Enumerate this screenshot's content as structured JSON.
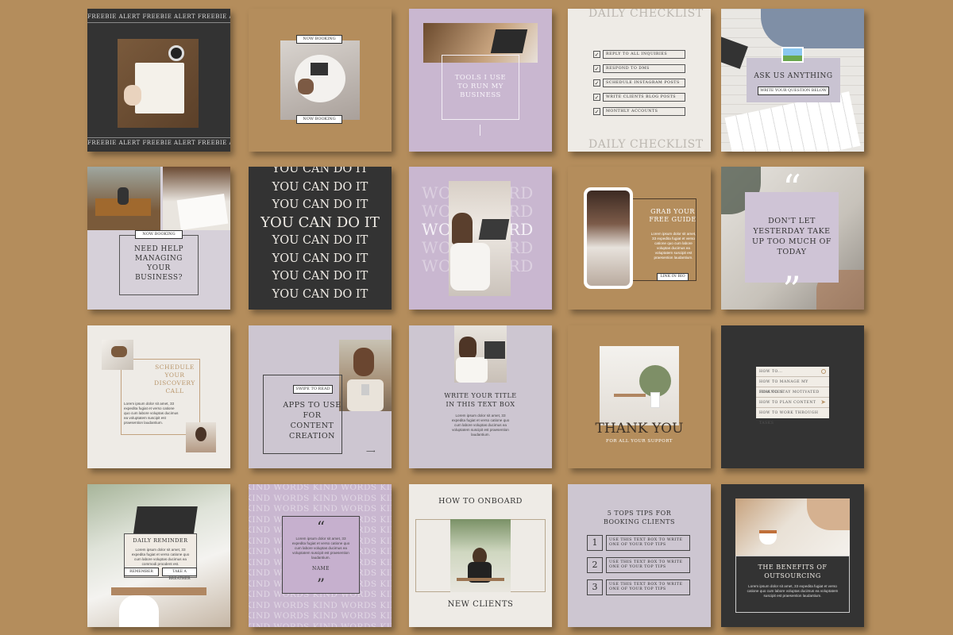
{
  "tiles": {
    "t1": {
      "banner": "FREEBIE ALERT",
      "banner_repeat": "FREEBIE ALERT  FREEBIE ALERT  FREEBIE ALERT"
    },
    "t2": {
      "top_label": "NOW BOOKING",
      "bottom_label": "NOW BOOKING"
    },
    "t3": {
      "text": "TOOLS I USE TO RUN MY BUSINESS"
    },
    "t4": {
      "title": "DAILY CHECKLIST",
      "items": [
        "REPLY TO ALL INQUIRIES",
        "RESPOND TO DMS",
        "SCHEDULE INSTAGRAM POSTS",
        "WRITE CLIENTS BLOG POSTS",
        "MONTHLY ACCOUNTS"
      ]
    },
    "t5": {
      "title": "ASK US ANYTHING",
      "field": "WRITE YOUR QUESTION BELOW"
    },
    "t6": {
      "label": "NOW BOOKING",
      "text": "NEED HELP MANAGING YOUR BUSINESS?"
    },
    "t7": {
      "line": "YOU CAN DO IT"
    },
    "t8": {
      "bg_word": "WORK HARD"
    },
    "t9": {
      "title": "GRAB YOUR FREE GUIDE",
      "body": "Lorem ipsum dolor sit amet, 33 expedita fugiat et verso catione quo cum labore voluptas ducimus ea voluptatem suscipit est praesention laudantium.",
      "button": "LINK IN BIO"
    },
    "t10": {
      "text": "DON'T LET YESTERDAY TAKE UP TOO MUCH OF TODAY",
      "open_quote": "“",
      "close_quote": "”"
    },
    "t11": {
      "title": "SCHEDULE YOUR DISCOVERY CALL",
      "body": "Lorem ipsum dolor sit amet, 33 expedita fugiat et verso catione quo cum labore voluptas ducimus ea voluptatem suscipit est praesention laudantium."
    },
    "t12": {
      "label": "SWIPE TO READ",
      "text": "APPS TO USE FOR CONTENT CREATION"
    },
    "t13": {
      "title": "WRITE YOUR TITLE IN THIS TEXT BOX",
      "body": "Lorem ipsum dolor sit amet, 33 expedita fugiat et verso catione quo cum labore voluptas ducimus ea voluptatem suscipit est praesention laudantium."
    },
    "t14": {
      "title": "THANK YOU",
      "subtitle": "FOR ALL YOUR SUPPORT"
    },
    "t15": {
      "search": "HOW TO...",
      "items": [
        "HOW TO MANAGE MY FINANCES",
        "HOW TO STAY MOTIVATED",
        "HOW TO PLAN CONTENT",
        "HOW TO WORK THROUGH TASKS"
      ]
    },
    "t16": {
      "title": "DAILY REMINDER",
      "body": "Lorem ipsum dolor sit amet, 33 expedita fugiat et verso catione quo cum labore voluptas ducimus ea commodi proodent est.",
      "btn1": "REMEMBER",
      "btn2": "TAKE A BREATHER"
    },
    "t17": {
      "bg_word": "KIND WORDS",
      "body": "Lorem ipsum dolor sit amet, 33 expedita fugiat et verso catione quo cum labore voluptas ducimus ea voluptatem suscipit est praesention laudantium.",
      "name": "NAME",
      "open_quote": "“",
      "close_quote": "”"
    },
    "t18": {
      "top": "HOW TO ONBOARD",
      "bottom": "NEW CLIENTS"
    },
    "t19": {
      "title": "5 TOPS TIPS FOR BOOKING CLIENTS",
      "tip": "USE THIS TEXT BOX TO WRITE ONE OF YOUR TOP TIPS",
      "numbers": [
        "1",
        "2",
        "3"
      ]
    },
    "t20": {
      "title": "THE BENEFITS OF OUTSOURCING",
      "body": "Lorem ipsum dolor sit amet, 33 expedita fugiat et verso catione quo cum labore voluptas ducimus ea voluptatem suscipit est praesention laudantium."
    }
  },
  "colors": {
    "background": "#b48d5c",
    "dark": "#333333",
    "lavender": "#c9b7d0",
    "grey_lavender": "#cdc6d1",
    "cream": "#eeebe6"
  },
  "icons": [
    "checkbox-icon",
    "search-icon",
    "cursor-icon",
    "arrow-right-icon",
    "quote-icon",
    "image-placeholder-icon"
  ]
}
